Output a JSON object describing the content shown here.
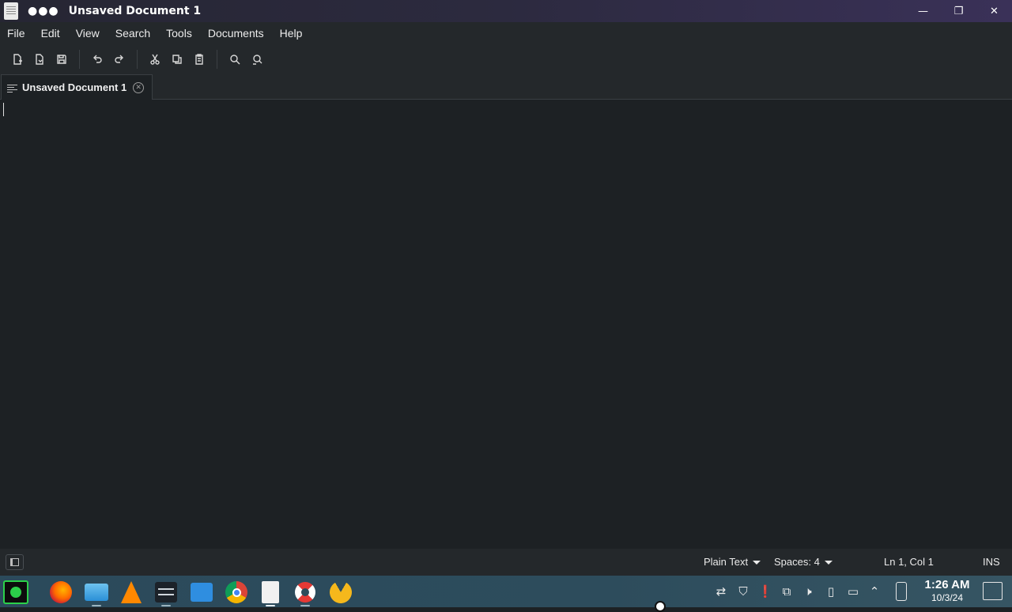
{
  "window": {
    "title": "Unsaved Document 1",
    "dots": "●●●",
    "controls": {
      "minimize": "—",
      "maximize": "❐",
      "close": "✕"
    }
  },
  "menubar": {
    "items": [
      "File",
      "Edit",
      "View",
      "Search",
      "Tools",
      "Documents",
      "Help"
    ]
  },
  "toolbar": {
    "buttons": [
      "new-document-icon",
      "open-document-icon",
      "save-icon",
      "undo-icon",
      "redo-icon",
      "cut-icon",
      "copy-icon",
      "paste-icon",
      "find-icon",
      "find-replace-icon"
    ]
  },
  "tabs": [
    {
      "label": "Unsaved Document 1",
      "close": "✕"
    }
  ],
  "editor": {
    "content": ""
  },
  "statusbar": {
    "language": "Plain Text",
    "indent": "Spaces: 4",
    "position": "Ln 1, Col 1",
    "mode": "INS"
  },
  "taskbar": {
    "apps": [
      "activity-monitor-icon",
      "firefox-icon",
      "file-manager-icon",
      "vlc-icon",
      "settings-sliders-icon",
      "remote-desktop-icon",
      "chrome-icon",
      "text-editor-icon",
      "help-lifebuoy-icon",
      "pacman-game-icon"
    ],
    "tray": [
      "sync-icon",
      "shield-icon",
      "clipboard-alert-icon",
      "clipboard-icon",
      "mute-icon",
      "battery-icon",
      "display-icon",
      "chevron-up-icon",
      "phone-icon"
    ],
    "clock": {
      "time": "1:26 AM",
      "date": "10/3/24"
    }
  },
  "colors": {
    "editor_bg": "#1d2124",
    "chrome_bg": "#24282b",
    "titlebar_accent": "#3a3158",
    "taskbar_bg": "#2d4c5c"
  }
}
